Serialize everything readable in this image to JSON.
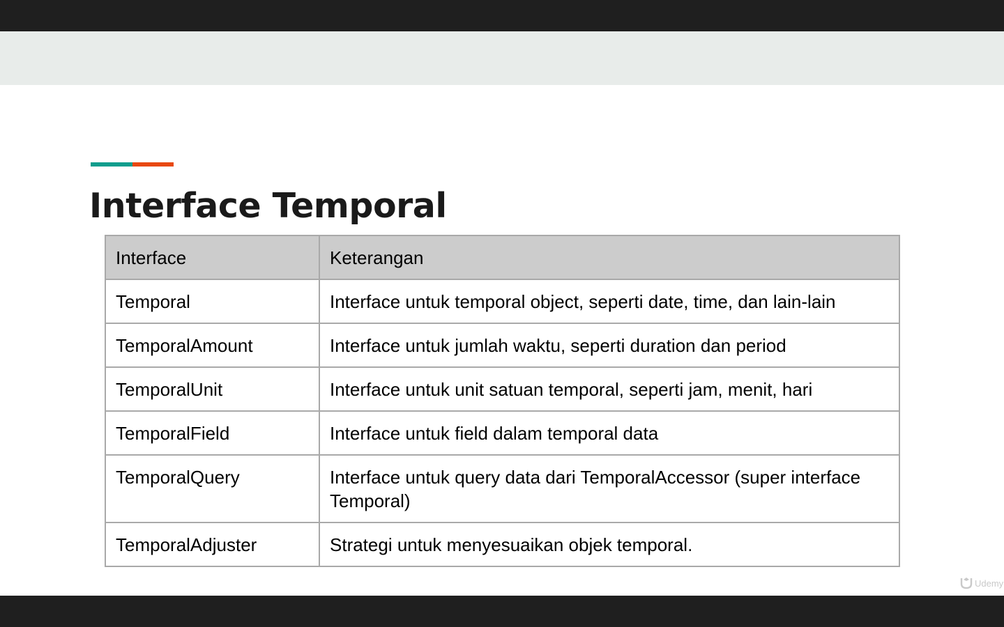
{
  "slide": {
    "title": "Interface Temporal",
    "accent_colors": {
      "teal": "#0f9d8d",
      "orange": "#e8480f"
    }
  },
  "table": {
    "headers": [
      "Interface",
      "Keterangan"
    ],
    "rows": [
      [
        "Temporal",
        "Interface untuk temporal object, seperti date, time, dan lain-lain"
      ],
      [
        "TemporalAmount",
        "Interface untuk jumlah waktu, seperti duration dan period"
      ],
      [
        "TemporalUnit",
        "Interface untuk unit satuan temporal, seperti jam, menit, hari"
      ],
      [
        "TemporalField",
        "Interface untuk field dalam temporal data"
      ],
      [
        "TemporalQuery",
        "Interface untuk query data dari TemporalAccessor (super interface Temporal)"
      ],
      [
        "TemporalAdjuster",
        "Strategi untuk menyesuaikan objek temporal."
      ]
    ]
  },
  "watermark": {
    "icon": "udemy-logo-icon",
    "text": "Udemy"
  }
}
